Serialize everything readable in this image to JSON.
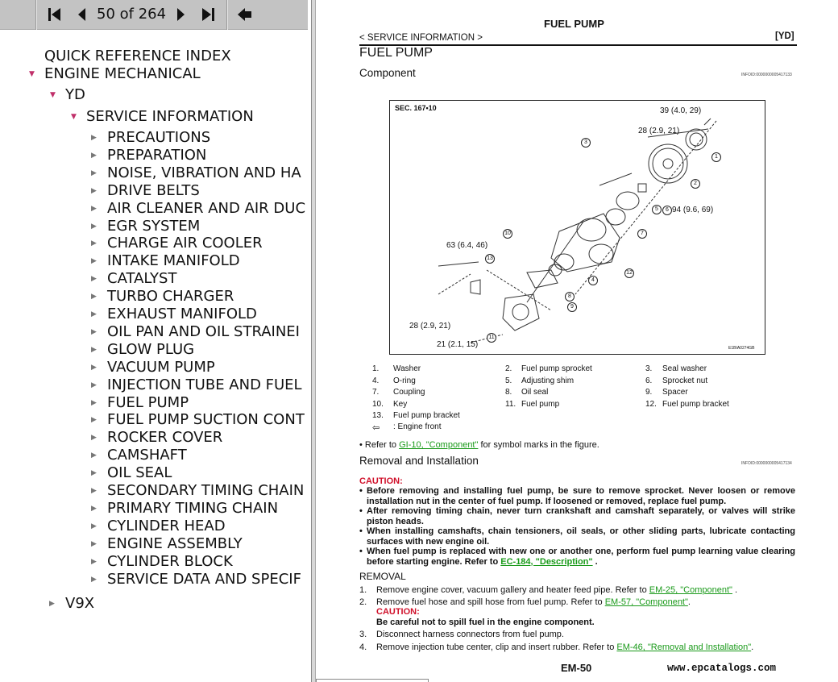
{
  "toolbar": {
    "page_indicator": "50 of 264",
    "first_icon": "first-page-icon",
    "prev_icon": "prev-page-icon",
    "next_icon": "next-page-icon",
    "last_icon": "last-page-icon",
    "back_icon": "back-arrow-icon"
  },
  "tree": {
    "quick_ref": "QUICK REFERENCE INDEX",
    "engine": "ENGINE MECHANICAL",
    "yd": "YD",
    "service": "SERVICE INFORMATION",
    "children": [
      "PRECAUTIONS",
      "PREPARATION",
      "NOISE, VIBRATION AND HA",
      "DRIVE BELTS",
      "AIR CLEANER AND AIR DUC",
      "EGR SYSTEM",
      "CHARGE AIR COOLER",
      "INTAKE MANIFOLD",
      "CATALYST",
      "TURBO CHARGER",
      "EXHAUST MANIFOLD",
      "OIL PAN AND OIL STRAINEI",
      "GLOW PLUG",
      "VACUUM PUMP",
      "INJECTION TUBE AND FUEL",
      "FUEL PUMP",
      "FUEL PUMP SUCTION CONT",
      "ROCKER COVER",
      "CAMSHAFT",
      "OIL SEAL",
      "SECONDARY TIMING CHAIN",
      "PRIMARY TIMING CHAIN",
      "CYLINDER HEAD",
      "ENGINE ASSEMBLY",
      "CYLINDER BLOCK",
      "SERVICE DATA AND SPECIF"
    ],
    "v9x": "V9X"
  },
  "doc": {
    "running_title": "FUEL PUMP",
    "breadcrumb": "< SERVICE INFORMATION >",
    "engine_code": "[YD]",
    "title": "FUEL PUMP",
    "component_heading": "Component",
    "infoid1": "INFOID:0000000005417133",
    "diagram": {
      "sec": "SEC. 167•10",
      "code": "E1BIA0274GB",
      "torques": [
        "39 (4.0, 29)",
        "28 (2.9, 21)",
        "94 (9.6, 69)",
        "63 (6.4, 46)",
        "28 (2.9, 21)",
        "21 (2.1, 15)"
      ],
      "callouts": [
        "1",
        "2",
        "3",
        "4",
        "5",
        "6",
        "7",
        "8",
        "9",
        "10",
        "11",
        "12",
        "13"
      ]
    },
    "legend": [
      {
        "n": "1.",
        "t": "Washer"
      },
      {
        "n": "2.",
        "t": "Fuel pump sprocket"
      },
      {
        "n": "3.",
        "t": "Seal washer"
      },
      {
        "n": "4.",
        "t": "O-ring"
      },
      {
        "n": "5.",
        "t": "Adjusting shim"
      },
      {
        "n": "6.",
        "t": "Sprocket nut"
      },
      {
        "n": "7.",
        "t": "Coupling"
      },
      {
        "n": "8.",
        "t": "Oil seal"
      },
      {
        "n": "9.",
        "t": "Spacer"
      },
      {
        "n": "10.",
        "t": "Key"
      },
      {
        "n": "11.",
        "t": "Fuel pump"
      },
      {
        "n": "12.",
        "t": "Fuel pump bracket"
      },
      {
        "n": "13.",
        "t": "Fuel pump bracket"
      }
    ],
    "engine_front": ": Engine front",
    "refer_pre": "• Refer to ",
    "refer_link": "GI-10, \"Component\"",
    "refer_post": " for symbol marks in the figure.",
    "removal_heading": "Removal and Installation",
    "infoid2": "INFOID:0000000005417134",
    "caution_label": "CAUTION:",
    "cautions": [
      "Before removing and installing fuel pump, be sure to remove sprocket. Never loosen or remove installation nut in the center of fuel pump. If loosened or removed, replace fuel pump.",
      "After removing timing chain, never turn crankshaft and camshaft separately, or valves will strike piston heads.",
      "When installing camshafts, chain tensioners, oil seals, or other sliding parts, lubricate contacting surfaces with new engine oil.",
      "When fuel pump is replaced with new one or another one, perform fuel pump learning value clearing before starting engine. Refer to "
    ],
    "caution4_link": "EC-184, \"Description\"",
    "removal_label": "REMOVAL",
    "steps": [
      {
        "n": "1.",
        "t": "Remove engine cover, vacuum gallery and heater feed pipe. Refer to ",
        "link": "EM-25, \"Component\"",
        "post": " ."
      },
      {
        "n": "2.",
        "t": "Remove fuel hose and spill hose from fuel pump. Refer to ",
        "link": "EM-57, \"Component\"",
        "post": "."
      },
      {
        "n": "3.",
        "t": "Disconnect harness connectors from fuel pump.",
        "link": "",
        "post": ""
      },
      {
        "n": "4.",
        "t": "Remove injection tube center, clip and insert rubber. Refer to ",
        "link": "EM-46, \"Removal and Installation\"",
        "post": "."
      }
    ],
    "step2_caution": "CAUTION:",
    "step2_caution_text": "Be careful not to spill fuel in the engine component.",
    "page_number": "EM-50",
    "watermark": "www.epcatalogs.com"
  },
  "colors": {
    "toolbar": "#c3c3c3",
    "link": "#1a9a1a",
    "caution": "#d0102a",
    "tree_arrow": "#c0306a"
  }
}
